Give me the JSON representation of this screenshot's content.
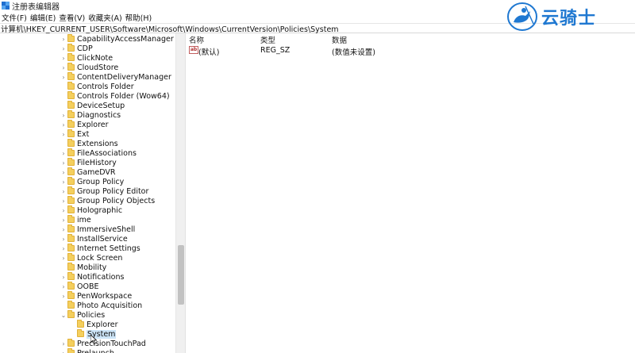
{
  "window": {
    "title": "注册表编辑器"
  },
  "menu": [
    "文件(F)",
    "编辑(E)",
    "查看(V)",
    "收藏夹(A)",
    "帮助(H)"
  ],
  "address": "计算机\\HKEY_CURRENT_USER\\Software\\Microsoft\\Windows\\CurrentVersion\\Policies\\System",
  "tree": [
    {
      "label": "CapabilityAccessManager",
      "expandable": true,
      "depth": 0
    },
    {
      "label": "CDP",
      "expandable": true,
      "depth": 0
    },
    {
      "label": "ClickNote",
      "expandable": true,
      "depth": 0
    },
    {
      "label": "CloudStore",
      "expandable": true,
      "depth": 0
    },
    {
      "label": "ContentDeliveryManager",
      "expandable": true,
      "depth": 0
    },
    {
      "label": "Controls Folder",
      "expandable": false,
      "depth": 0
    },
    {
      "label": "Controls Folder (Wow64)",
      "expandable": false,
      "depth": 0
    },
    {
      "label": "DeviceSetup",
      "expandable": false,
      "depth": 0
    },
    {
      "label": "Diagnostics",
      "expandable": true,
      "depth": 0
    },
    {
      "label": "Explorer",
      "expandable": true,
      "depth": 0
    },
    {
      "label": "Ext",
      "expandable": true,
      "depth": 0
    },
    {
      "label": "Extensions",
      "expandable": false,
      "depth": 0
    },
    {
      "label": "FileAssociations",
      "expandable": true,
      "depth": 0
    },
    {
      "label": "FileHistory",
      "expandable": true,
      "depth": 0
    },
    {
      "label": "GameDVR",
      "expandable": true,
      "depth": 0
    },
    {
      "label": "Group Policy",
      "expandable": true,
      "depth": 0
    },
    {
      "label": "Group Policy Editor",
      "expandable": true,
      "depth": 0
    },
    {
      "label": "Group Policy Objects",
      "expandable": true,
      "depth": 0
    },
    {
      "label": "Holographic",
      "expandable": true,
      "depth": 0
    },
    {
      "label": "ime",
      "expandable": true,
      "depth": 0
    },
    {
      "label": "ImmersiveShell",
      "expandable": true,
      "depth": 0
    },
    {
      "label": "InstallService",
      "expandable": true,
      "depth": 0
    },
    {
      "label": "Internet Settings",
      "expandable": true,
      "depth": 0
    },
    {
      "label": "Lock Screen",
      "expandable": true,
      "depth": 0
    },
    {
      "label": "Mobility",
      "expandable": false,
      "depth": 0
    },
    {
      "label": "Notifications",
      "expandable": true,
      "depth": 0
    },
    {
      "label": "OOBE",
      "expandable": true,
      "depth": 0
    },
    {
      "label": "PenWorkspace",
      "expandable": true,
      "depth": 0
    },
    {
      "label": "Photo Acquisition",
      "expandable": false,
      "depth": 0
    },
    {
      "label": "Policies",
      "expandable": true,
      "expanded": true,
      "depth": 0
    },
    {
      "label": "Explorer",
      "expandable": false,
      "depth": 1
    },
    {
      "label": "System",
      "expandable": false,
      "depth": 1,
      "selected": true
    },
    {
      "label": "PrecisionTouchPad",
      "expandable": true,
      "depth": 0
    },
    {
      "label": "Prelaunch",
      "expandable": true,
      "depth": 0
    }
  ],
  "list": {
    "columns": {
      "name": "名称",
      "type": "类型",
      "data": "数据"
    },
    "rows": [
      {
        "name": "(默认)",
        "type": "REG_SZ",
        "data": "(数值未设置)",
        "icon": "ab"
      }
    ]
  },
  "logo": {
    "text": "云骑士"
  }
}
